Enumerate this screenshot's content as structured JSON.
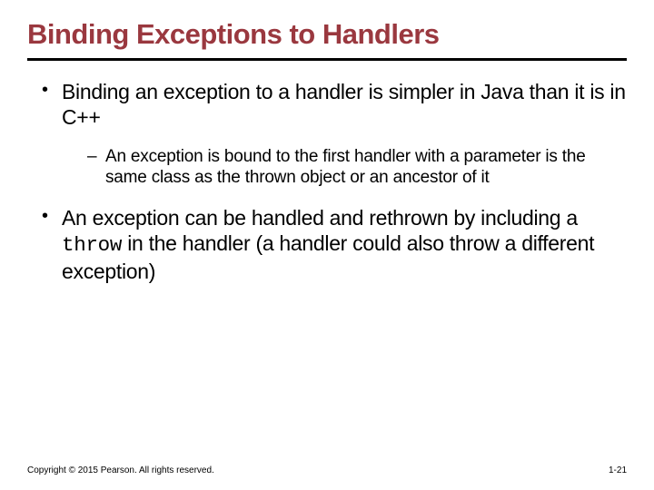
{
  "title": "Binding Exceptions to Handlers",
  "bullets": {
    "b1": "Binding an exception to a handler is simpler in Java than it is in C++",
    "b1_sub1": "An exception is bound to the first handler with a parameter is the same class as the thrown object or an ancestor of it",
    "b2_pre": "An exception can be handled and rethrown by including a ",
    "b2_code": "throw",
    "b2_post": " in the handler (a handler could also throw a different exception)"
  },
  "footer": {
    "copyright": "Copyright © 2015 Pearson. All rights reserved.",
    "page": "1-21"
  }
}
